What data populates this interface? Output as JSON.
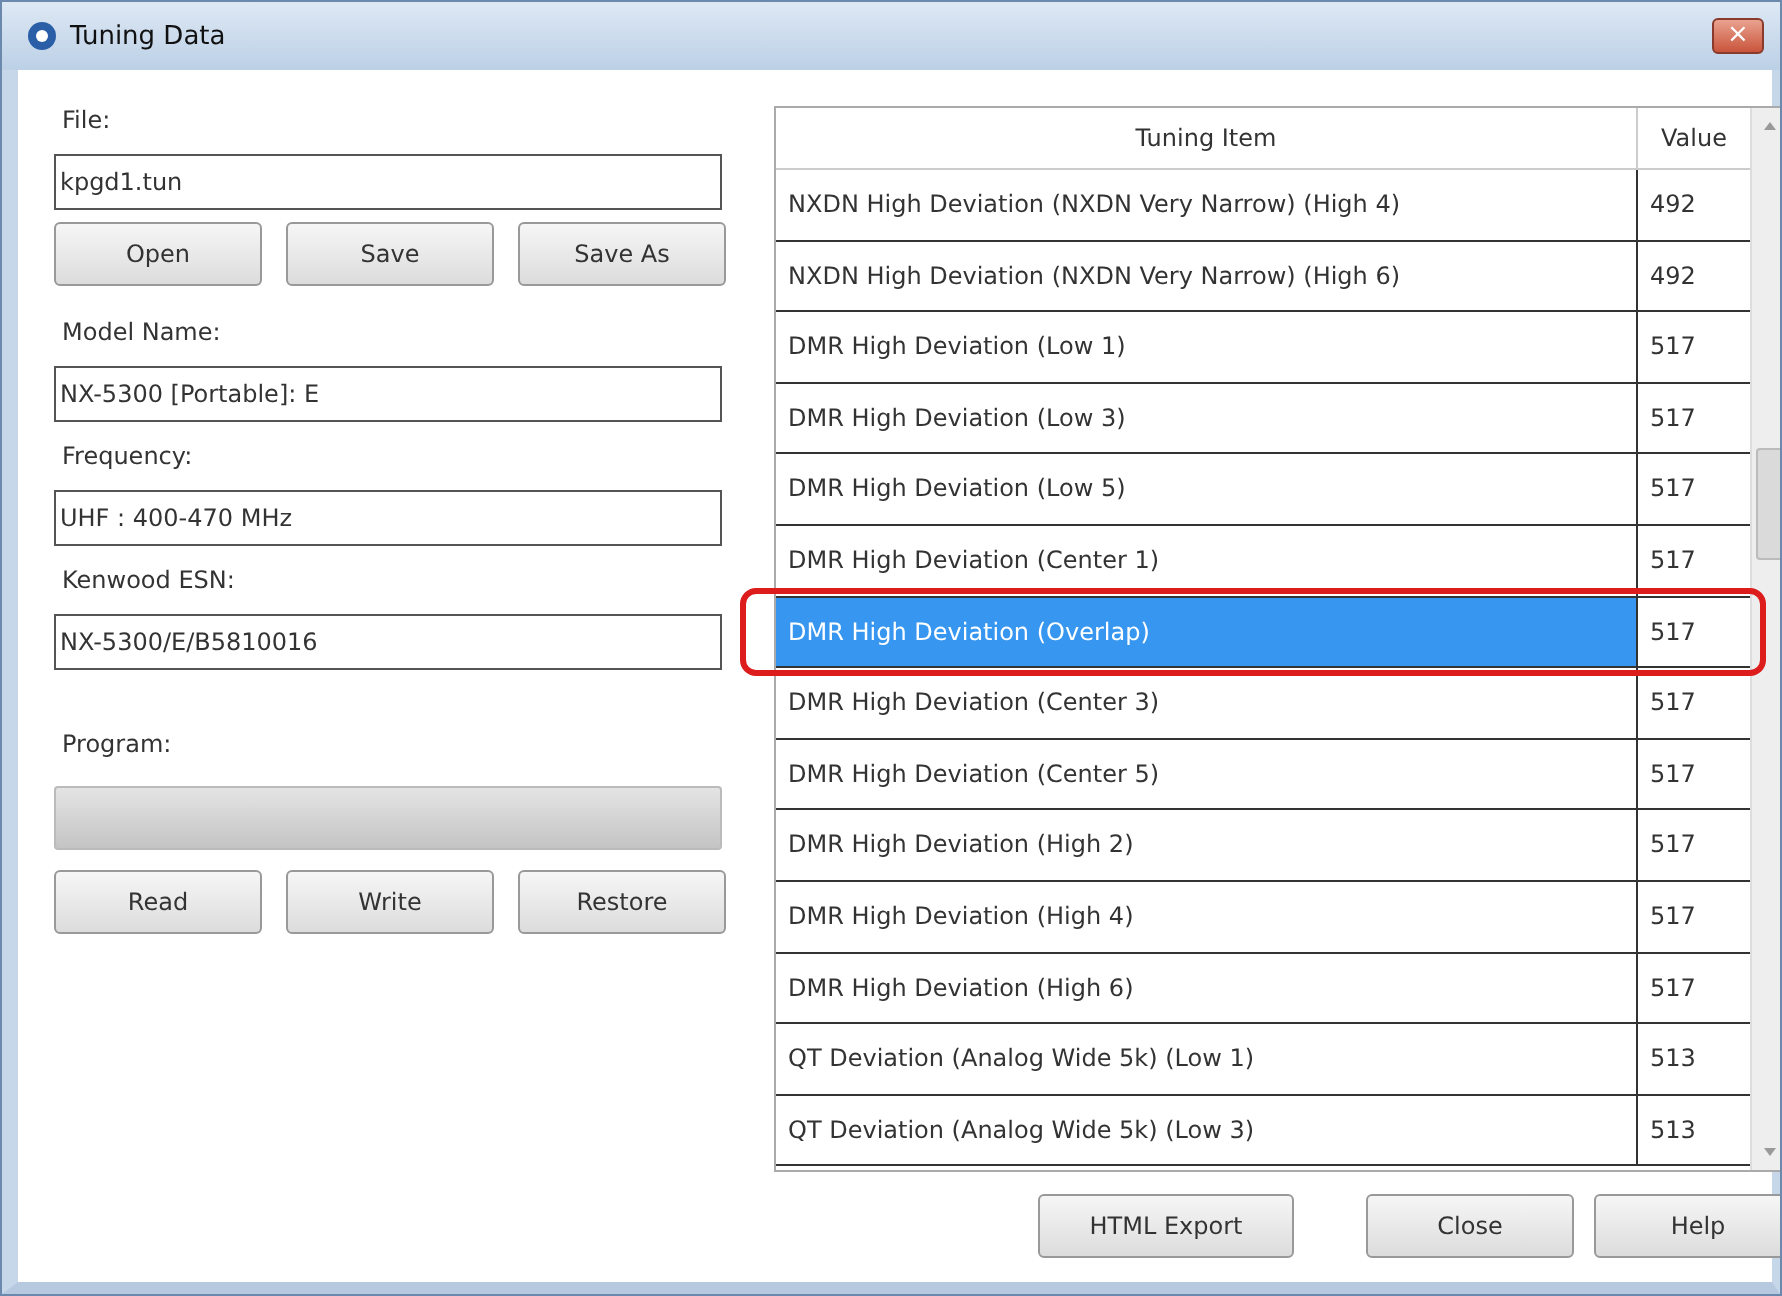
{
  "window": {
    "title": "Tuning Data",
    "close": "×"
  },
  "left": {
    "file_label": "File:",
    "file_value": "kpgd1.tun",
    "file_buttons": [
      "Open",
      "Save",
      "Save As"
    ],
    "fields": [
      {
        "label": "Model Name:",
        "value": "NX-5300 [Portable]: E"
      },
      {
        "label": "Frequency:",
        "value": "UHF : 400-470 MHz"
      },
      {
        "label": "Kenwood ESN:",
        "value": "NX-5300/E/B5810016"
      }
    ],
    "program_label": "Program:",
    "progress": {
      "level": 0
    },
    "program_buttons": [
      "Read",
      "Write",
      "Restore"
    ]
  },
  "table": {
    "columns": [
      "Tuning Item",
      "Value"
    ],
    "rows": [
      {
        "item": "NXDN High Deviation (NXDN Very Narrow) (High 4)",
        "value": "492",
        "selected": false,
        "circled": false
      },
      {
        "item": "NXDN High Deviation (NXDN Very Narrow) (High 6)",
        "value": "492",
        "selected": false,
        "circled": false
      },
      {
        "item": "DMR High Deviation (Low 1)",
        "value": "517",
        "selected": false,
        "circled": false
      },
      {
        "item": "DMR High Deviation (Low 3)",
        "value": "517",
        "selected": false,
        "circled": false
      },
      {
        "item": "DMR High Deviation (Low 5)",
        "value": "517",
        "selected": false,
        "circled": false
      },
      {
        "item": "DMR High Deviation (Center 1)",
        "value": "517",
        "selected": false,
        "circled": false
      },
      {
        "item": "DMR High Deviation (Overlap)",
        "value": "517",
        "selected": true,
        "circled": true
      },
      {
        "item": "DMR High Deviation (Center 3)",
        "value": "517",
        "selected": false,
        "circled": false
      },
      {
        "item": "DMR High Deviation (Center 5)",
        "value": "517",
        "selected": false,
        "circled": false
      },
      {
        "item": "DMR High Deviation (High 2)",
        "value": "517",
        "selected": false,
        "circled": false
      },
      {
        "item": "DMR High Deviation (High 4)",
        "value": "517",
        "selected": false,
        "circled": false
      },
      {
        "item": "DMR High Deviation (High 6)",
        "value": "517",
        "selected": false,
        "circled": false
      },
      {
        "item": "QT Deviation (Analog Wide 5k) (Low 1)",
        "value": "513",
        "selected": false,
        "circled": false
      },
      {
        "item": "QT Deviation (Analog Wide 5k) (Low 3)",
        "value": "513",
        "selected": false,
        "circled": false
      }
    ]
  },
  "buttons": [
    "HTML Export",
    "Close",
    "Help"
  ]
}
